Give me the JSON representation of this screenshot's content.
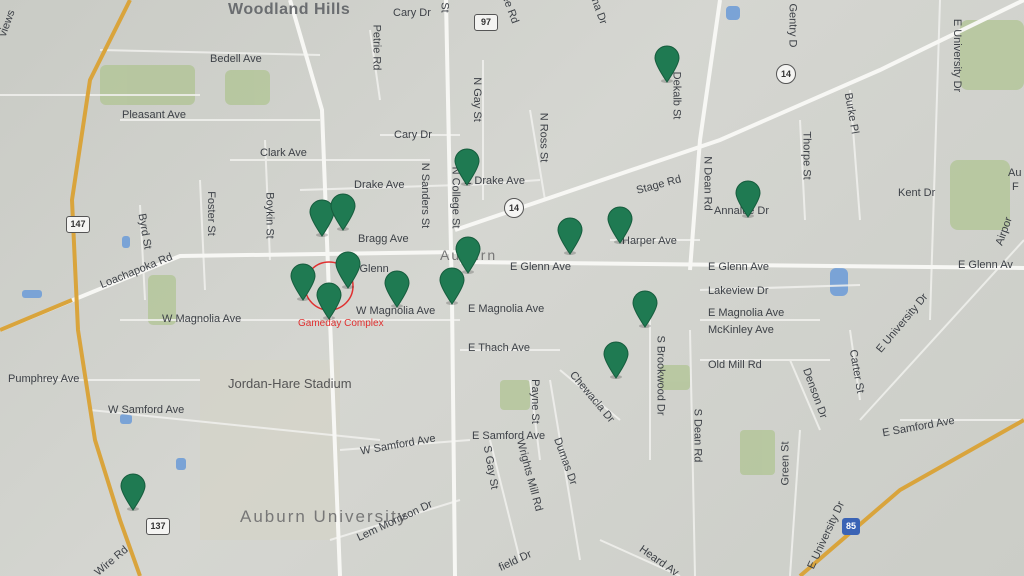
{
  "map": {
    "area_labels": {
      "woodland_hills": "Woodland Hills",
      "auburn_university": "Auburn University",
      "auburn": "Auburn",
      "stadium": "Jordan-Hare Stadium"
    },
    "streets": {
      "cary_dr_top": "Cary Dr",
      "cary_dr": "Cary Dr",
      "st_top": "St",
      "ee_rd": "ee Rd",
      "na_dr": "na Dr",
      "gentry_d": "Gentry D",
      "e_university_dr_top": "E University Dr",
      "views": "views",
      "bedell_ave": "Bedell Ave",
      "petrie_rd": "Petrie Rd",
      "pleasant_ave": "Pleasant Ave",
      "n_gay_st": "N Gay St",
      "n_ross_st": "N Ross St",
      "dekalb_st": "Dekalb St",
      "burke_pl": "Burke Pl",
      "clark_ave": "Clark Ave",
      "thorpe_st": "Thorpe St",
      "drake_ave": "Drake Ave",
      "e_drake_ave": "E Drake Ave",
      "n_sanders_st": "N Sanders St",
      "n_college_st": "N College St",
      "stage_rd": "Stage Rd",
      "n_dean_rd": "N Dean Rd",
      "annalue_dr": "Annalue Dr",
      "kent_dr": "Kent Dr",
      "byrd_st": "Byrd St",
      "foster_st": "Foster St",
      "boykin_st": "Boykin St",
      "loachapoka_rd": "Loachapoka Rd",
      "bragg_ave": "Bragg Ave",
      "harper_ave": "Harper Ave",
      "w_glenn": "W Glenn",
      "e_glenn_ave": "E Glenn Ave",
      "e_glenn_ave_2": "E Glenn Ave",
      "e_glenn_ave_right": "E Glenn Av",
      "lakeview_dr": "Lakeview Dr",
      "w_magnolia_ave": "W Magnolia Ave",
      "w_magnolia_ave_2": "W Magnolia Ave",
      "e_magnolia_ave": "E Magnolia Ave",
      "e_magnolia_ave_2": "E Magnolia Ave",
      "mckinley_ave": "McKinley Ave",
      "e_university_dr": "E University Dr",
      "e_thach_ave": "E Thach Ave",
      "s_brookwood_dr": "S Brookwood Dr",
      "old_mill_rd": "Old Mill Rd",
      "carter_st": "Carter St",
      "denson_dr": "Denson Dr",
      "pumphrey_ave": "Pumphrey Ave",
      "chewacla_dr": "Chewacla Dr",
      "payne_st": "Payne St",
      "w_samford_ave": "W Samford Ave",
      "w_samford_ave_2": "W Samford Ave",
      "e_samford_ave": "E Samford Ave",
      "e_samford_ave_right": "E Samford Ave",
      "s_dean_rd": "S Dean Rd",
      "green_st": "Green St",
      "dumas_dr": "Dumas Dr",
      "wrights_mill_rd": "Wrights Mill Rd",
      "s_gay_st": "S Gay St",
      "lem_morrison_dr": "Lem Morrison Dr",
      "e_university_dr_bottom": "E University Dr",
      "field_dr": "field Dr",
      "heard_av": "Heard Av",
      "wire_rd": "Wire Rd",
      "alpine": "Airpor",
      "au": "Au",
      "f": "F"
    },
    "shields": {
      "r97": "97",
      "r14a": "14",
      "r14b": "14",
      "r147": "147",
      "r137": "137",
      "r85": "85"
    },
    "annotation": "Gameday Complex",
    "colors": {
      "pin": "#1f7a52",
      "pin_dark": "#165c3d",
      "highway": "#d9a43c",
      "annotation": "#e03030",
      "park": "#a9c08e",
      "water": "#7aa3d6"
    },
    "pin_count": 18
  }
}
